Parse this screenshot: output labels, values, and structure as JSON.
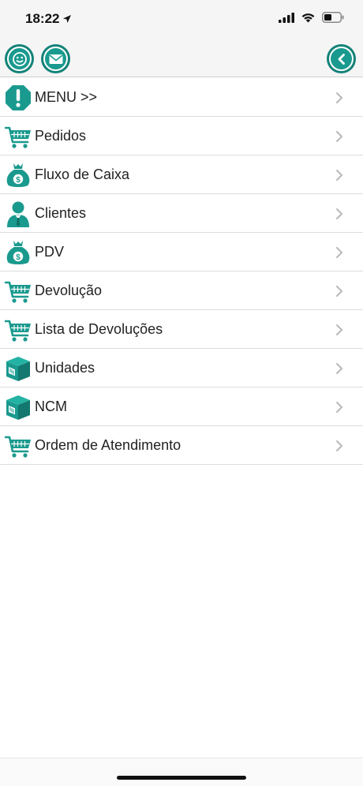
{
  "status_bar": {
    "time": "18:22"
  },
  "colors": {
    "accent": "#1a9a8e",
    "text": "#222222",
    "divider": "#dcdcdc"
  },
  "toolbar": {
    "left_icons": [
      "smiley-icon",
      "mail-icon"
    ],
    "right_icon": "back-chevron-icon"
  },
  "menu": {
    "items": [
      {
        "label": "MENU >>",
        "icon": "alert-octagon-icon"
      },
      {
        "label": "Pedidos",
        "icon": "shopping-cart-icon"
      },
      {
        "label": "Fluxo de Caixa",
        "icon": "money-bag-icon"
      },
      {
        "label": "Clientes",
        "icon": "person-icon"
      },
      {
        "label": "PDV",
        "icon": "money-bag-icon"
      },
      {
        "label": "Devolução",
        "icon": "shopping-cart-icon"
      },
      {
        "label": "Lista de Devoluções",
        "icon": "shopping-cart-icon"
      },
      {
        "label": "Unidades",
        "icon": "box-icon"
      },
      {
        "label": "NCM",
        "icon": "box-icon"
      },
      {
        "label": "Ordem de Atendimento",
        "icon": "shopping-cart-icon"
      }
    ]
  }
}
